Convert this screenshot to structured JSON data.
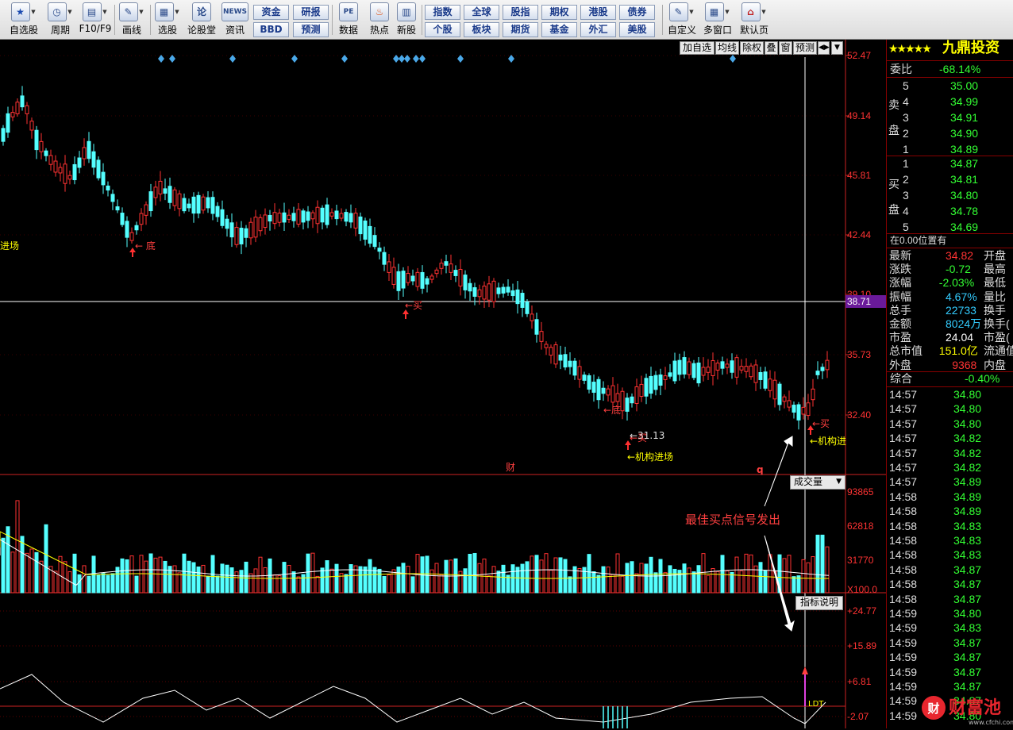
{
  "toolbar": {
    "items": [
      {
        "label": "自选股",
        "icon": "star-icon"
      },
      {
        "label": "周期",
        "icon": "clock-icon"
      },
      {
        "label": "F10/F9",
        "icon": "f10-icon"
      },
      {
        "label": "画线",
        "icon": "pencil-icon"
      },
      {
        "label": "选股",
        "icon": "stock-picker-icon"
      },
      {
        "label": "论股堂",
        "icon": "forum-icon",
        "glyph": "论"
      },
      {
        "label": "资讯",
        "icon": "news-icon",
        "glyph": "NEWS"
      },
      {
        "label": "数据",
        "icon": "pe-data-icon",
        "glyph": "PE"
      },
      {
        "label": "热点",
        "icon": "fire-icon"
      },
      {
        "label": "新股",
        "icon": "new-stock-icon"
      },
      {
        "label": "自定义",
        "icon": "customize-icon"
      },
      {
        "label": "多窗口",
        "icon": "multi-window-icon"
      },
      {
        "label": "默认页",
        "icon": "home-icon"
      }
    ],
    "pairs": [
      {
        "top": "资金",
        "bottom": "BBD"
      },
      {
        "top": "研报",
        "bottom": "预测"
      },
      {
        "top": "指数",
        "bottom": "个股"
      },
      {
        "top": "全球",
        "bottom": "板块"
      },
      {
        "top": "股指",
        "bottom": "期货"
      },
      {
        "top": "期权",
        "bottom": "基金"
      },
      {
        "top": "港股",
        "bottom": "外汇"
      },
      {
        "top": "债券",
        "bottom": "美股"
      }
    ]
  },
  "mini_toolbar": [
    "加自选",
    "均线",
    "除权",
    "叠",
    "窗",
    "预测"
  ],
  "price_axis": [
    "52.47",
    "49.14",
    "45.81",
    "42.44",
    "39.10",
    "35.73",
    "32.40"
  ],
  "crosshair_price": "38.71",
  "vol_axis": [
    "93865",
    "62818",
    "31770",
    "X100.0"
  ],
  "ind_axis": [
    "+24.77",
    "+15.89",
    "+6.81",
    "-2.07"
  ],
  "annotations": {
    "di1": "底",
    "mai1": "买",
    "di2": "底",
    "mai2": "买",
    "low_price": "31.13",
    "jigou1": "机构进场",
    "jigou2": "机构进",
    "mai3": "买",
    "jinchang_left": "进场",
    "cai": "财",
    "q": "q",
    "signal": "最佳买点信号发出",
    "ldt": "LDT"
  },
  "volume_selector": "成交量",
  "indicator_btn": "指标说明",
  "right_panel": {
    "title": "九鼎投资",
    "weibi_label": "委比",
    "weibi_value": "-68.14%",
    "sell_label_1": "卖",
    "sell_label_2": "盘",
    "buy_label_1": "买",
    "buy_label_2": "盘",
    "sells": [
      {
        "n": "5",
        "p": "35.00"
      },
      {
        "n": "4",
        "p": "34.99"
      },
      {
        "n": "3",
        "p": "34.91"
      },
      {
        "n": "2",
        "p": "34.90"
      },
      {
        "n": "1",
        "p": "34.89"
      }
    ],
    "buys": [
      {
        "n": "1",
        "p": "34.87"
      },
      {
        "n": "2",
        "p": "34.81"
      },
      {
        "n": "3",
        "p": "34.80"
      },
      {
        "n": "4",
        "p": "34.78"
      },
      {
        "n": "5",
        "p": "34.69"
      }
    ],
    "position": "在0.00位置有",
    "stats": [
      {
        "l": "最新",
        "v": "34.82",
        "r": "开盘",
        "c": "#ff3333"
      },
      {
        "l": "涨跌",
        "v": "-0.72",
        "r": "最高",
        "c": "#33ff33"
      },
      {
        "l": "涨幅",
        "v": "-2.03%",
        "r": "最低",
        "c": "#33ff33"
      },
      {
        "l": "振幅",
        "v": "4.67%",
        "r": "量比",
        "c": "#33ccff"
      },
      {
        "l": "总手",
        "v": "22733",
        "r": "换手",
        "c": "#33ccff"
      },
      {
        "l": "金额",
        "v": "8024万",
        "r": "换手(",
        "c": "#33ccff"
      },
      {
        "l": "市盈",
        "v": "24.04",
        "r": "市盈(",
        "c": "#ffffff"
      },
      {
        "l": "总市值",
        "v": "151.0亿",
        "r": "流通值",
        "c": "#ffff00"
      },
      {
        "l": "外盘",
        "v": "9368",
        "r": "内盘",
        "c": "#ff3333"
      }
    ],
    "zonghe_label": "综合",
    "zonghe_value": "-0.40%",
    "ticks": [
      {
        "t": "14:57",
        "p": "34.80"
      },
      {
        "t": "14:57",
        "p": "34.80"
      },
      {
        "t": "14:57",
        "p": "34.80"
      },
      {
        "t": "14:57",
        "p": "34.82"
      },
      {
        "t": "14:57",
        "p": "34.82"
      },
      {
        "t": "14:57",
        "p": "34.82"
      },
      {
        "t": "14:57",
        "p": "34.89"
      },
      {
        "t": "14:58",
        "p": "34.89"
      },
      {
        "t": "14:58",
        "p": "34.89"
      },
      {
        "t": "14:58",
        "p": "34.83"
      },
      {
        "t": "14:58",
        "p": "34.83"
      },
      {
        "t": "14:58",
        "p": "34.83"
      },
      {
        "t": "14:58",
        "p": "34.87"
      },
      {
        "t": "14:58",
        "p": "34.87"
      },
      {
        "t": "14:58",
        "p": "34.87"
      },
      {
        "t": "14:59",
        "p": "34.80"
      },
      {
        "t": "14:59",
        "p": "34.83"
      },
      {
        "t": "14:59",
        "p": "34.87"
      },
      {
        "t": "14:59",
        "p": "34.87"
      },
      {
        "t": "14:59",
        "p": "34.87"
      },
      {
        "t": "14:59",
        "p": "34.87"
      },
      {
        "t": "14:59",
        "p": "34.87"
      },
      {
        "t": "14:59",
        "p": "34.80"
      }
    ]
  },
  "watermark": {
    "brand": "财富池",
    "url": "www.cfchi.com"
  },
  "colors": {
    "up": "#ff3232",
    "down": "#54ffff",
    "axis": "#cc2222",
    "label": "#ff3333",
    "yellow": "#ffff00"
  }
}
